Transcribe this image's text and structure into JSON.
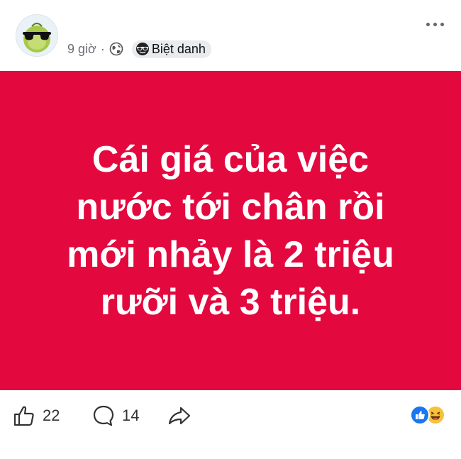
{
  "post": {
    "time": "9 giờ",
    "separator": "·",
    "nickname_label": "Biệt danh",
    "body_lines": [
      "Cái giá của việc",
      "nước tới chân rồi",
      "mới nhảy là 2 triệu",
      "rưỡi và 3 triệu."
    ],
    "banner_color": "#e3093f"
  },
  "actions": {
    "like_count": "22",
    "comment_count": "14"
  },
  "icons": {
    "avatar": "sunglasses-fruit-avatar",
    "privacy": "globe-icon",
    "badge": "sunglasses-emoji-icon",
    "more": "more-options-icon",
    "like": "thumbs-up-icon",
    "comment": "comment-bubble-icon",
    "share": "share-arrow-icon",
    "reactions": [
      "like-reaction-icon",
      "haha-reaction-icon"
    ]
  }
}
